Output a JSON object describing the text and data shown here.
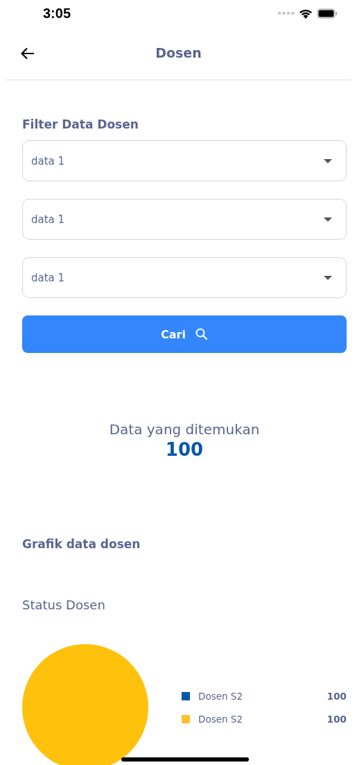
{
  "status_bar": {
    "time": "3:05"
  },
  "nav": {
    "title": "Dosen"
  },
  "filter": {
    "title": "Filter Data Dosen",
    "dropdowns": [
      {
        "value": "data 1"
      },
      {
        "value": "data 1"
      },
      {
        "value": "data 1"
      }
    ],
    "button": "Cari"
  },
  "result": {
    "label": "Data yang ditemukan",
    "count": "100"
  },
  "chart_section": {
    "title": "Grafik data dosen",
    "subtitle": "Status Dosen",
    "legend": [
      {
        "label": "Dosen S2",
        "value": "100",
        "color": "#0057a8"
      },
      {
        "label": "Dosen S2",
        "value": "100",
        "color": "#fec22f"
      }
    ]
  }
}
